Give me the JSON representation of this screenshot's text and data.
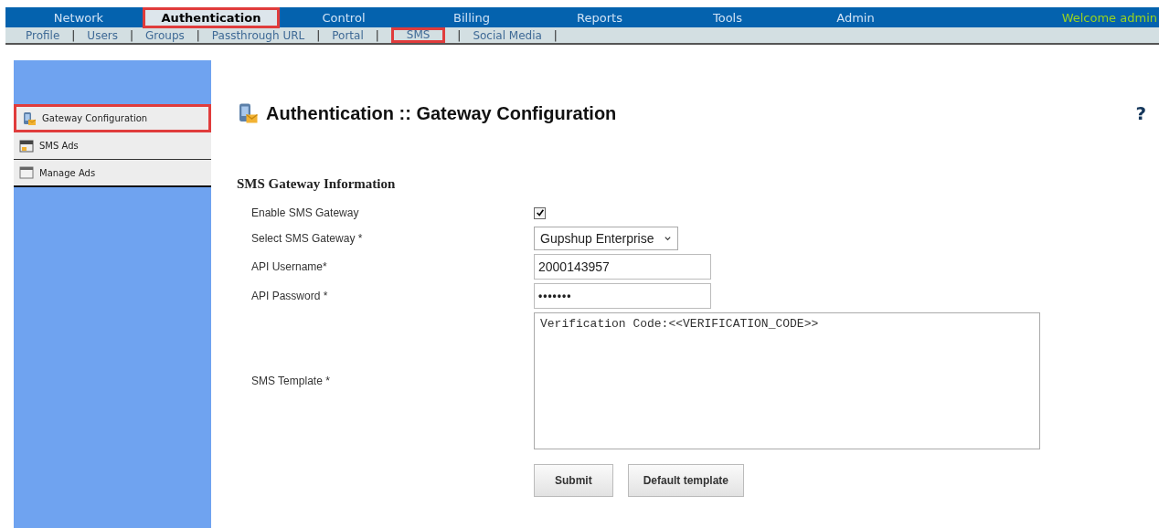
{
  "top_nav": {
    "tabs": [
      {
        "label": "Network",
        "selected": false
      },
      {
        "label": "Authentication",
        "selected": true
      },
      {
        "label": "Control",
        "selected": false
      },
      {
        "label": "Billing",
        "selected": false
      },
      {
        "label": "Reports",
        "selected": false
      },
      {
        "label": "Tools",
        "selected": false
      },
      {
        "label": "Admin",
        "selected": false
      }
    ],
    "welcome": "Welcome admin"
  },
  "sub_nav": {
    "items": [
      {
        "label": "Profile",
        "selected": false
      },
      {
        "label": "Users",
        "selected": false
      },
      {
        "label": "Groups",
        "selected": false
      },
      {
        "label": "Passthrough URL",
        "selected": false
      },
      {
        "label": "Portal",
        "selected": false
      },
      {
        "label": "SMS",
        "selected": true
      },
      {
        "label": "Social Media",
        "selected": false
      }
    ],
    "separator": "|"
  },
  "sidebar": {
    "items": [
      {
        "label": "Gateway Configuration",
        "selected": true,
        "kind": "gateway"
      },
      {
        "label": "SMS Ads",
        "selected": false,
        "kind": "ads"
      },
      {
        "label": "Manage Ads",
        "selected": false,
        "kind": "manage"
      }
    ]
  },
  "page": {
    "title": "Authentication :: Gateway Configuration",
    "help": "?",
    "section": "SMS Gateway Information",
    "fields": [
      {
        "kind": "checkbox",
        "label": "Enable SMS Gateway",
        "checked": true
      },
      {
        "kind": "select",
        "label": "Select SMS Gateway *",
        "value": "Gupshup Enterprise"
      },
      {
        "kind": "text",
        "label": "API Username*",
        "value": "2000143957"
      },
      {
        "kind": "password",
        "label": "API Password *",
        "value": "•••••••"
      },
      {
        "kind": "textarea",
        "label": "SMS Template *",
        "value": "Verification Code:<<VERIFICATION_CODE>>"
      }
    ],
    "buttons": [
      "Submit",
      "Default template"
    ]
  }
}
